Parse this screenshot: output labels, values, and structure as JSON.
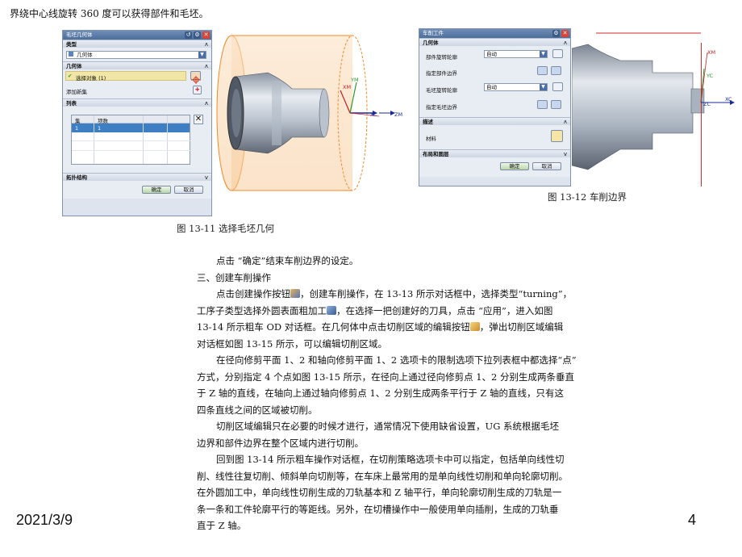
{
  "top_line": "界绕中心线旋转 360 度可以获得部件和毛坯。",
  "fig11": {
    "dialog_title": "毛坯几何体",
    "type_section": "类型",
    "type_value": "几何体",
    "geometry_section": "几何体",
    "select_object": "选择对象 (1)",
    "add_new_set": "添加新集",
    "list_section": "列表",
    "col_set": "集",
    "col_items": "项数",
    "row_set": "1",
    "row_items": "1",
    "topology_section": "拓扑结构",
    "ok": "确定",
    "cancel": "取消",
    "axis_ym": "YM",
    "axis_xm": "XM",
    "axis_xc": "XC",
    "axis_zm": "ZM",
    "caption": "图 13-11  选择毛坯几何"
  },
  "fig12": {
    "dialog_title": "车削工件",
    "geometry_section": "几何体",
    "part_rot_contour": "部件旋转轮廓",
    "part_rot_value": "自动",
    "specify_part_boundary": "指定部件边界",
    "blank_rot_contour": "毛坯旋转轮廓",
    "blank_rot_value": "自动",
    "specify_blank_boundary": "指定毛坯边界",
    "description_section": "描述",
    "material": "材料",
    "layout_section": "布局和图层",
    "ok": "确定",
    "cancel": "取消",
    "axis_xm": "XM",
    "axis_yc": "YC",
    "axis_xc": "XC",
    "axis_zc": "ZC",
    "caption": "图 13-12  车削边界"
  },
  "body": {
    "p1": "点击 “确定”结束车削边界的设定。",
    "p2": "三、创建车削操作",
    "p3a": "点击创建操作按钮",
    "p3b": "，创建车削操作，在 13-13 所示对话框中，选择类型“turning”，",
    "p3c": "工序子类型选择外圆表面粗加工",
    "p3d": "，在选择一把创建好的刀具，点击 “应用”，进入如图",
    "p3e": "13-14 所示粗车 OD 对话框。在几何体中点击切削区域的编辑按钮",
    "p3f": "，弹出切削区域编辑",
    "p3g": "对话框如图 13-15 所示，可以编辑切削区域。",
    "p4a": "在径向修剪平面 1、2 和轴向修剪平面 1、2 选项卡的限制选项下拉列表框中都选择“点”",
    "p4b": "方式，分别指定 4 个点如图 13-15 所示，在径向上通过径向修剪点 1、2 分别生成两条垂直",
    "p4c": "于 Z 轴的直线，在轴向上通过轴向修剪点 1、2 分别生成两条平行于 Z 轴的直线，只有这",
    "p4d": "四条直线之间的区域被切削。",
    "p5a": "切削区域编辑只在必要的时候才进行，通常情况下使用缺省设置，UG 系统根据毛坯",
    "p5b": "边界和部件边界在整个区域内进行切削。",
    "p6a": "回到图 13-14 所示粗车操作对话框，在切削策略选项卡中可以指定，包括单向线性切",
    "p6b": "削、线性往复切削、倾斜单向切削等，在车床上最常用的是单向线性切削和单向轮廓切削。",
    "p6c": "在外圆加工中，单向线性切削生成的刀轨基本和 Z 轴平行，单向轮廓切削生成的刀轨是一",
    "p6d": "条一条和工件轮廓平行的等距线。另外，在切槽操作中一般使用单向插削，生成的刀轨垂",
    "p6e": "直于 Z 轴。"
  },
  "footer": {
    "date": "2021/3/9",
    "page": "4"
  }
}
